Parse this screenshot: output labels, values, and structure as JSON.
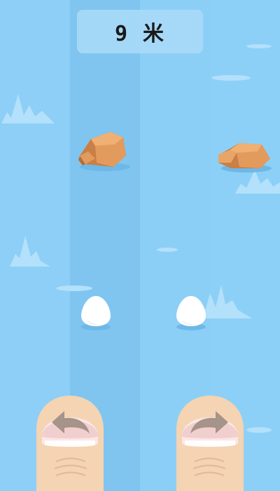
{
  "hud": {
    "distance_text": "9 米"
  },
  "colors": {
    "water_light": "#8dcff6",
    "water_dark": "#7fc5f0",
    "wave": "#b3e0fb",
    "rock_top": "#e8a163",
    "rock_side": "#c97f45",
    "egg": "#ffffff",
    "skin": "#f4d4b2",
    "nail": "#fbe7e6"
  },
  "controls": {
    "left_icon": "turn-left-arrow-icon",
    "right_icon": "turn-right-arrow-icon"
  }
}
